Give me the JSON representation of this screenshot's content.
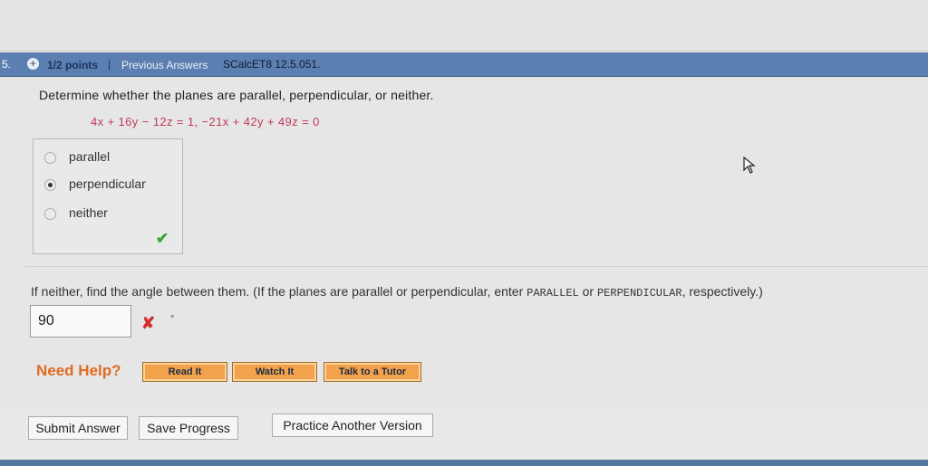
{
  "header": {
    "question_number": "5.",
    "plus_symbol": "+",
    "points": "1/2 points",
    "separator": "|",
    "previous_answers": "Previous Answers",
    "problem_code": "SCalcET8 12.5.051."
  },
  "question": {
    "prompt": "Determine whether the planes are parallel, perpendicular, or neither.",
    "equation": "4x + 16y − 12z = 1,   −21x + 42y + 49z = 0"
  },
  "choices": {
    "options": [
      "parallel",
      "perpendicular",
      "neither"
    ],
    "selected": "perpendicular"
  },
  "angle_part": {
    "prompt_prefix": "If neither, find the angle between them. (If the planes are parallel or perpendicular, enter ",
    "parallel_word": "PARALLEL",
    "or_word": " or ",
    "perpendicular_word": "PERPENDICULAR",
    "prompt_suffix": ", respectively.)",
    "answer_value": "90",
    "degree_symbol": "°"
  },
  "help": {
    "label": "Need Help?",
    "read_it": "Read It",
    "watch_it": "Watch It",
    "talk_to_tutor": "Talk to a Tutor"
  },
  "actions": {
    "submit": "Submit Answer",
    "save": "Save Progress",
    "practice": "Practice Another Version"
  },
  "colors": {
    "header_bar": "#5a7fb0",
    "equation": "#c23a5a",
    "need_help": "#e06a22",
    "help_button": "#f3a24c",
    "correct": "#38a33a",
    "incorrect": "#d0312d"
  }
}
